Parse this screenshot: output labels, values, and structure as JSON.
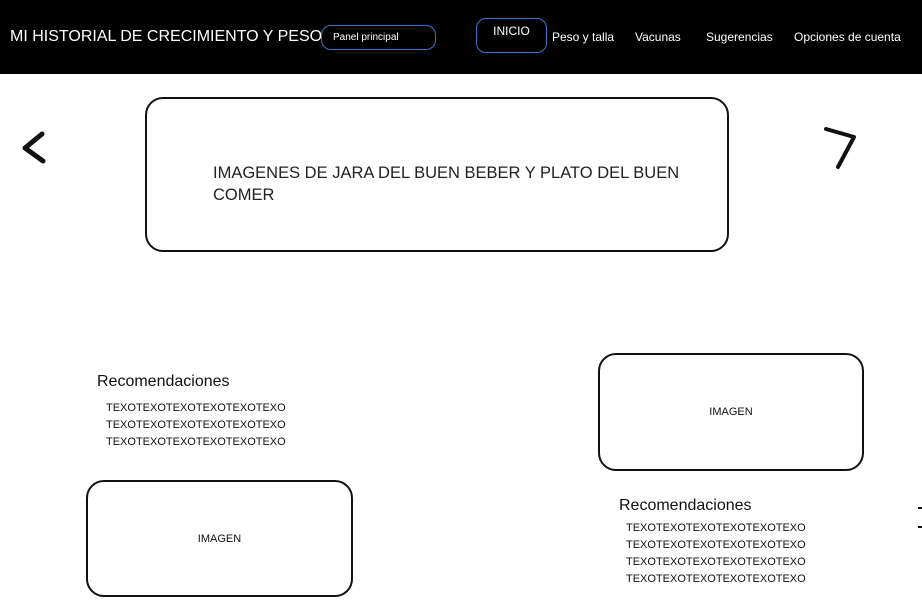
{
  "header": {
    "title": "MI HISTORIAL DE CRECIMIENTO Y PESO",
    "panel_button": "Panel principal",
    "inicio_button": "INICIO",
    "nav": {
      "peso_talla": "Peso y talla",
      "vacunas": "Vacunas",
      "sugerencias": "Sugerencias",
      "opciones_cuenta": "Opciones de cuenta"
    }
  },
  "carousel": {
    "prev_icon": "chevron-left-icon",
    "next_icon": "chevron-right-icon",
    "banner_text": "IMAGENES DE JARA DEL BUEN BEBER Y PLATO DEL BUEN COMER"
  },
  "left_section": {
    "title": "Recomendaciones",
    "lines": [
      "TEXOTEXOTEXOTEXOTEXOTEXO",
      "TEXOTEXOTEXOTEXOTEXOTEXO",
      "TEXOTEXOTEXOTEXOTEXOTEXO"
    ],
    "image_label": "IMAGEN"
  },
  "right_section": {
    "image_label": "IMAGEN",
    "title": "Recomendaciones",
    "lines": [
      "TEXOTEXOTEXOTEXOTEXOTEXO",
      "TEXOTEXOTEXOTEXOTEXOTEXO",
      "TEXOTEXOTEXOTEXOTEXOTEXO",
      "TEXOTEXOTEXOTEXOTEXOTEXO"
    ]
  },
  "colors": {
    "header_background": "#000000",
    "header_text": "#ffffff",
    "button_outline": "#3b74c6",
    "page_background": "#ffffff",
    "sketch_lines": "#111111"
  }
}
